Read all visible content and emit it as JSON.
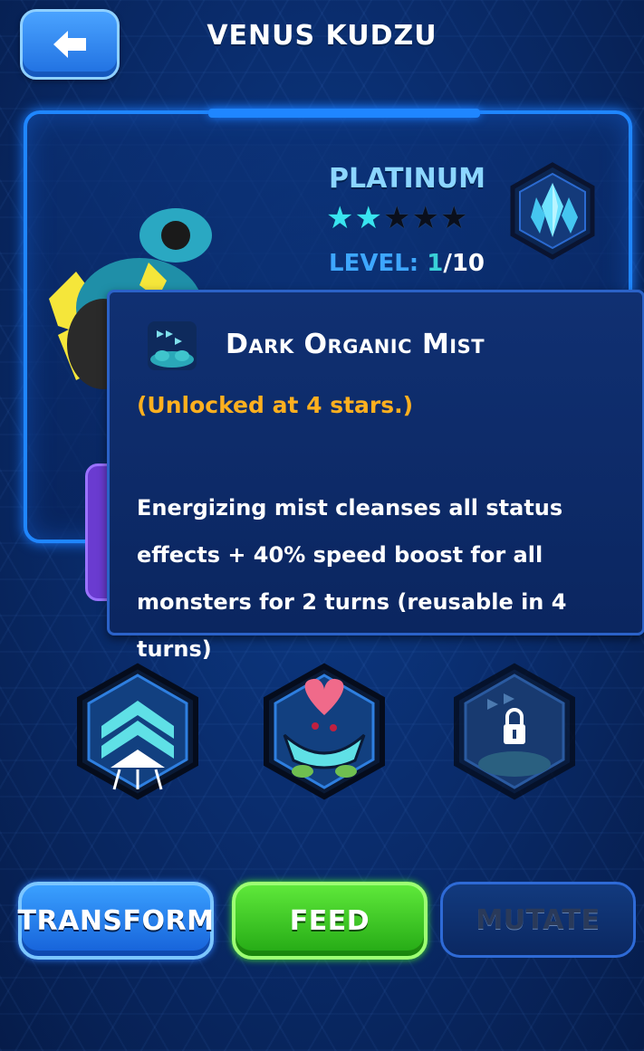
{
  "header": {
    "title": "VENUS KUDZU",
    "back_icon": "arrow-left-icon"
  },
  "monster": {
    "rarity": "PLATINUM",
    "stars_total": 5,
    "stars_filled": 2,
    "level_label": "LEVEL:",
    "level_current": "1",
    "level_max": "/10",
    "rank_icon": "crystal-icon"
  },
  "tooltip": {
    "title": "Dark Organic Mist",
    "unlock_text": "(Unlocked at 4 stars.)",
    "description": "Energizing mist cleanses all status effects + 40% speed boost for all monsters for 2 turns (reusable in 4 turns)"
  },
  "abilities": [
    {
      "icon": "chevron-spike-icon",
      "locked": false
    },
    {
      "icon": "heart-plant-icon",
      "locked": false
    },
    {
      "icon": "mist-lock-icon",
      "locked": true
    }
  ],
  "buttons": {
    "transform": "TRANSFORM",
    "feed": "FEED",
    "mutate": "MUTATE"
  },
  "colors": {
    "accent_blue": "#1f86ff",
    "unlock_orange": "#ffb01f",
    "feed_green": "#3fdf30",
    "star_cyan": "#39e4f0"
  }
}
